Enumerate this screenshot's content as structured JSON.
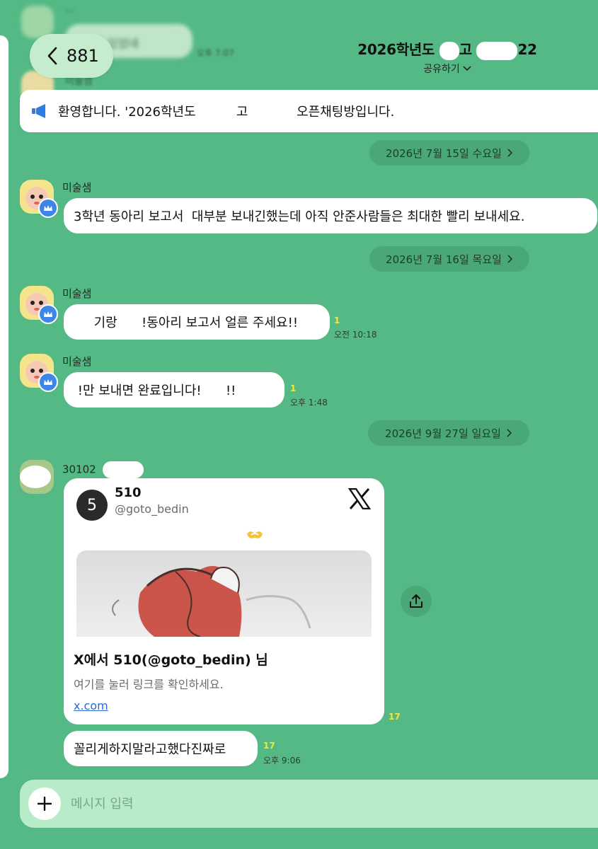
{
  "header": {
    "back_count": "881",
    "title_prefix": "2026학년도",
    "title_mid": "고",
    "title_suffix": "22",
    "share_label": "공유하기"
  },
  "ghost": {
    "bubble_text": "기 있었네",
    "time": "오후 7:07",
    "sender2": "미술샘"
  },
  "notice": {
    "text": "환영합니다. '2026학년도          고            오픈채팅방입니다."
  },
  "dates": {
    "d1": "2026년 7월 15일 수요일",
    "d2": "2026년 7월 16일 목요일",
    "d3": "2026년 9월 27일 일요일"
  },
  "messages": [
    {
      "sender": "미술샘",
      "text": "3학년 동아리 보고서  대부분 보내긴했는데 아직 안준사람들은 최대한 빨리 보내세요."
    },
    {
      "sender": "미술샘",
      "text": "     기랑      !동아리 보고서 얼른 주세요!!",
      "unread": "1",
      "time": "오전 10:18"
    },
    {
      "sender": "미술샘",
      "text": " !만 보내면 완료입니다!      !!",
      "unread": "1",
      "time": "오후 1:48"
    }
  ],
  "link_message": {
    "sender": "30102",
    "account_avatar": "5",
    "account_name": "510",
    "account_handle": "@goto_bedin",
    "card_title": "X에서 510(@goto_bedin) 님",
    "card_desc": "여기를 눌러 링크를 확인하세요.",
    "card_link": "x.com",
    "unread": "17"
  },
  "last_message": {
    "text": "꼴리게하지말라고했다진짜로",
    "unread": "17",
    "time": "오후 9:06"
  },
  "input": {
    "placeholder": "메시지 입력"
  },
  "colors": {
    "background": "#54b985",
    "bubble": "#ffffff",
    "unread": "#f5e63a",
    "input_bar": "#b8ecc9"
  }
}
